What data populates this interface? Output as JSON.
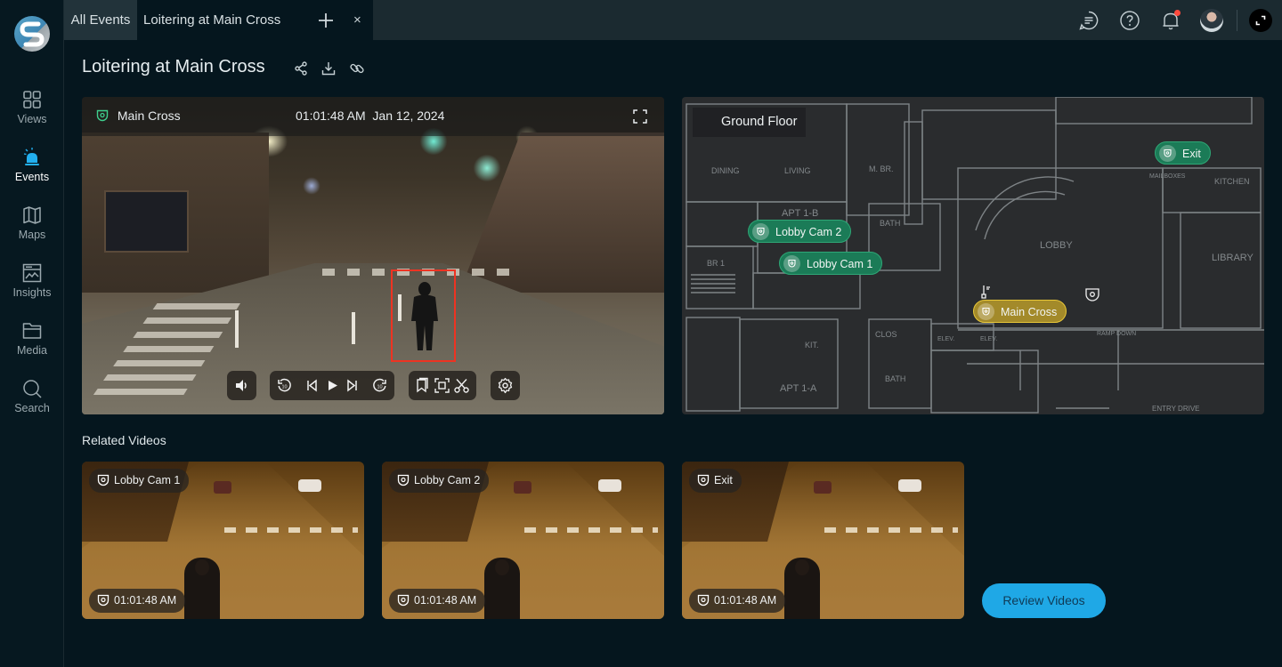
{
  "app": {
    "logo": "brand-logo"
  },
  "sidebar": {
    "items": [
      {
        "label": "Views",
        "icon": "grid-icon",
        "active": false
      },
      {
        "label": "Events",
        "icon": "siren-icon",
        "active": true
      },
      {
        "label": "Maps",
        "icon": "map-icon",
        "active": false
      },
      {
        "label": "Insights",
        "icon": "chart-icon",
        "active": false
      },
      {
        "label": "Media",
        "icon": "folder-icon",
        "active": false
      },
      {
        "label": "Search",
        "icon": "search-icon",
        "active": false
      }
    ]
  },
  "tabs": {
    "items": [
      {
        "label": "All Events",
        "active": false
      },
      {
        "label": "Loitering at Main Cross",
        "active": true,
        "closable": true
      }
    ],
    "close_glyph": "×",
    "add_icon": "plus-icon"
  },
  "topbar": {
    "icons": [
      "chat-icon",
      "help-icon",
      "bell-icon",
      "avatar",
      "expand-icon"
    ],
    "has_notification": true,
    "notification_color": "#ff4a3d"
  },
  "header": {
    "title": "Loitering at Main Cross",
    "actions": [
      "share-icon",
      "download-icon",
      "link-icon"
    ]
  },
  "video": {
    "camera": "Main Cross",
    "time": "01:01:48 AM",
    "date": "Jan 12, 2024",
    "bbox_color": "#ee3322",
    "controls": {
      "volume": "volume-icon",
      "playback": [
        "rewind-10-icon",
        "skip-back-icon",
        "play-icon",
        "skip-forward-icon",
        "forward-10-icon"
      ],
      "tools": [
        "bookmark-icon",
        "snapshot-icon",
        "clip-icon"
      ],
      "settings": "gear-icon"
    }
  },
  "map": {
    "floor": "Ground Floor",
    "labels": [
      "DINING",
      "LIVING",
      "M. BR.",
      "BATH",
      "APT 1-B",
      "BR 1",
      "LOBBY",
      "LIBRARY",
      "KITCHEN",
      "MAILBOXES",
      "KIT.",
      "CLOS",
      "ELEV.",
      "ELEV.",
      "APT 1-A",
      "RAMP DOWN",
      "ENTRY DRIVE",
      "BATH"
    ],
    "pins": [
      {
        "label": "Lobby Cam 2",
        "status": "green"
      },
      {
        "label": "Lobby Cam 1",
        "status": "green"
      },
      {
        "label": "Exit",
        "status": "green"
      },
      {
        "label": "Main Cross",
        "status": "selected"
      }
    ],
    "colors": {
      "green": "#1b7b57",
      "selected": "#a38a2a"
    }
  },
  "related": {
    "title": "Related Videos",
    "videos": [
      {
        "camera": "Lobby Cam 1",
        "time": "01:01:48 AM"
      },
      {
        "camera": "Lobby Cam 2",
        "time": "01:01:48 AM"
      },
      {
        "camera": "Exit",
        "time": "01:01:48 AM"
      }
    ],
    "review_label": "Review Videos",
    "review_color": "#1fa8e6"
  }
}
